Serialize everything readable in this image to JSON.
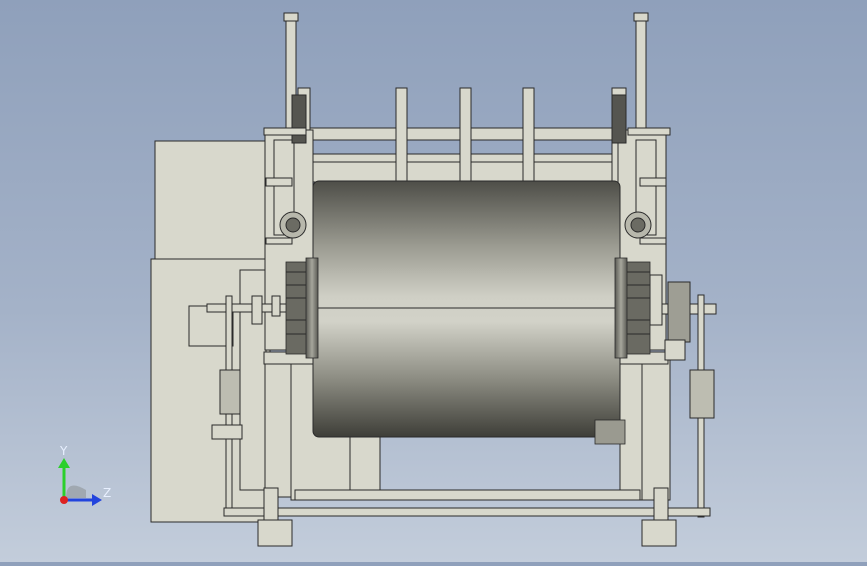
{
  "viewport": {
    "background_top": "#8fa0bb",
    "background_bottom": "#c3cddb",
    "part_color": "#d8d8cc",
    "edge_color": "#2a2a2a",
    "drum_light": "#c8c8be",
    "drum_dark": "#4a4a44"
  },
  "triad": {
    "y_label": "Y",
    "z_label": "Z",
    "y_color": "#2bd02b",
    "z_color": "#2244dd",
    "x_color": "#dd2222"
  },
  "icons": [
    "coordinate-triad-icon"
  ]
}
